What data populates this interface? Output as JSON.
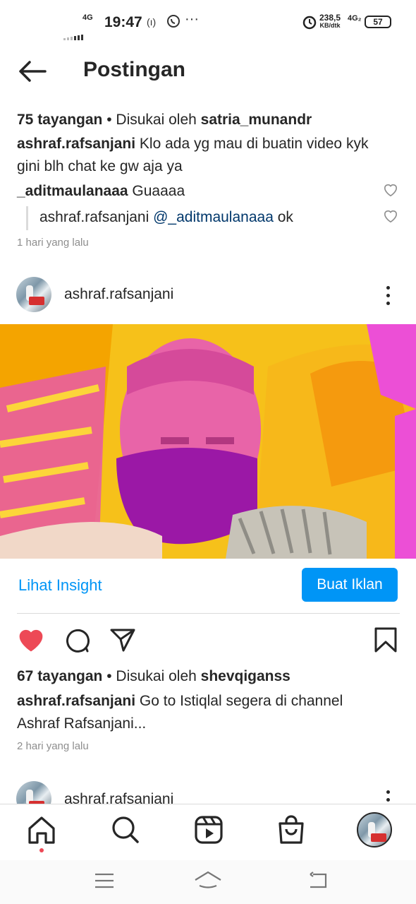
{
  "status": {
    "time": "19:47",
    "network": "4G",
    "speed_value": "238,5",
    "speed_unit": "KB/dtk",
    "network2": "4G₂",
    "battery": "57"
  },
  "header": {
    "title": "Postingan"
  },
  "post1": {
    "views": "75 tayangan",
    "liked_by_prefix": " • Disukai oleh ",
    "liked_by_user": "satria_munandr",
    "caption_user": "ashraf.rafsanjani",
    "caption_line1": " Klo ada yg mau di buatin video kyk",
    "caption_line2": "gini blh chat ke gw aja ya",
    "comment_user": "_aditmaulanaaa",
    "comment_text": " Guaaaa",
    "reply_user": "ashraf.rafsanjani",
    "reply_mention": " @_aditmaulanaaa",
    "reply_text": " ok",
    "time": "1 hari yang lalu"
  },
  "post2": {
    "username": "ashraf.rafsanjani",
    "insight_label": "Lihat Insight",
    "ads_label": "Buat Iklan",
    "views": "67 tayangan",
    "liked_by_prefix": " • Disukai oleh ",
    "liked_by_user": "shevqiganss",
    "caption_user": "ashraf.rafsanjani",
    "caption_line1": " Go to Istiqlal segera di channel",
    "caption_line2": "Ashraf Rafsanjani...",
    "time": "2 hari yang lalu",
    "liked": true
  },
  "post3": {
    "username": "ashraf.rafsanjani"
  },
  "colors": {
    "accent": "#0095f6",
    "like": "#ed4956",
    "text": "#262626",
    "muted": "#8e8e8e"
  },
  "nav": [
    "home-icon",
    "search-icon",
    "reels-icon",
    "shop-icon",
    "profile-avatar"
  ]
}
